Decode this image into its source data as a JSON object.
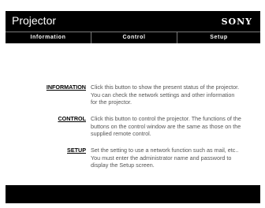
{
  "header": {
    "title": "Projector",
    "brand": "SONY"
  },
  "tabs": [
    {
      "label": "Information"
    },
    {
      "label": "Control"
    },
    {
      "label": "Setup"
    }
  ],
  "items": [
    {
      "link": "INFORMATION",
      "description": "Click this button to show the present status of the projector. You can check the network settings and other information for the projector."
    },
    {
      "link": "CONTROL",
      "description": "Click this button to control the projector. The functions of the buttons on the control window are the same as those on the supplied remote control."
    },
    {
      "link": "SETUP",
      "description": "Set the setting to use a network function such as mail, etc.. You must enter the administrator name and password to display the Setup screen."
    }
  ]
}
